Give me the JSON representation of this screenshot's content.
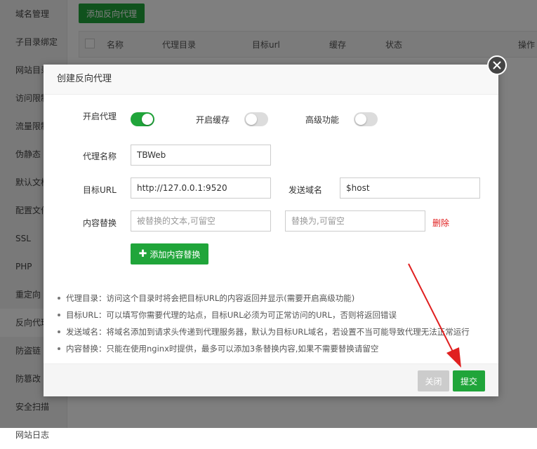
{
  "sidebar": {
    "items": [
      {
        "label": "域名管理"
      },
      {
        "label": "子目录绑定"
      },
      {
        "label": "网站目录"
      },
      {
        "label": "访问限制"
      },
      {
        "label": "流量限制"
      },
      {
        "label": "伪静态"
      },
      {
        "label": "默认文档"
      },
      {
        "label": "配置文件"
      },
      {
        "label": "SSL"
      },
      {
        "label": "PHP"
      },
      {
        "label": "重定向"
      },
      {
        "label": "反向代理"
      },
      {
        "label": "防盗链"
      },
      {
        "label": "防篡改"
      },
      {
        "label": "安全扫描"
      },
      {
        "label": "网站日志"
      }
    ],
    "active_index": 11
  },
  "main": {
    "add_button": "添加反向代理",
    "columns": [
      "名称",
      "代理目录",
      "目标url",
      "缓存",
      "状态",
      "操作"
    ]
  },
  "dialog": {
    "title": "创建反向代理",
    "toggles": {
      "proxy": {
        "label": "开启代理",
        "on": true
      },
      "cache": {
        "label": "开启缓存",
        "on": false
      },
      "advanced": {
        "label": "高级功能",
        "on": false
      }
    },
    "proxy_name": {
      "label": "代理名称",
      "value": "TBWeb"
    },
    "target_url": {
      "label": "目标URL",
      "value": "http://127.0.0.1:9520"
    },
    "send_domain": {
      "label": "发送域名",
      "value": "$host"
    },
    "content_replace": {
      "label": "内容替换",
      "from_placeholder": "被替换的文本,可留空",
      "to_placeholder": "替换为,可留空",
      "delete_label": "删除"
    },
    "add_replace_button": "添加内容替换",
    "notes": [
      "代理目录：访问这个目录时将会把目标URL的内容返回并显示(需要开启高级功能)",
      "目标URL：可以填写你需要代理的站点，目标URL必须为可正常访问的URL，否则将返回错误",
      "发送域名：将域名添加到请求头传递到代理服务器，默认为目标URL域名，若设置不当可能导致代理无法正常运行",
      "内容替换：只能在使用nginx时提供，最多可以添加3条替换内容,如果不需要替换请留空"
    ],
    "footer": {
      "close_label": "关闭",
      "submit_label": "提交"
    }
  },
  "colors": {
    "accent": "#20a53a",
    "danger": "#e02020",
    "arrow": "#e02020"
  }
}
